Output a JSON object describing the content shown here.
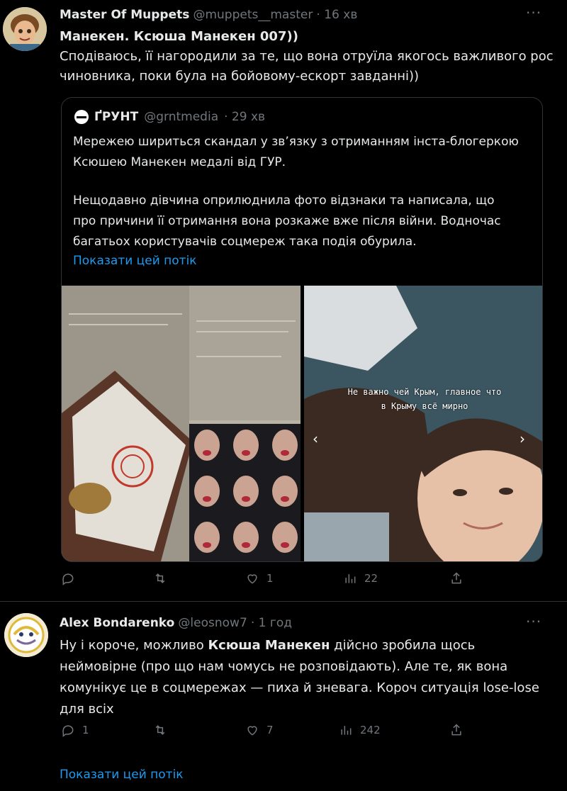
{
  "tweet1": {
    "name": "Master Of Muppets",
    "handle": "@muppets__master",
    "time": "· 16 хв",
    "line1": "Манекен. Ксюша Манекен 007))",
    "line2": "Сподіваюсь, її нагородили за те, що вона отруїла якогось важливого рос",
    "line3": "чиновника, поки була на бойовому-ескорт завданні))",
    "actions": {
      "reply": "",
      "retweet": "",
      "like": "1",
      "views": "22"
    }
  },
  "quote": {
    "name": "ҐРУНТ",
    "handle": "@grntmedia",
    "time": "· 29 хв",
    "p1_line1": "Мережею шириться скандал у зв’язку з отриманням інста-блогеркою",
    "p1_line2": "Ксюшею Манекен медалі від ГУР.",
    "p2_line1": "Нещодавно дівчина оприлюднила фото відзнаки та написала, що",
    "p2_line2": "про причини її отримання вона розкаже вже після війни. Водночас",
    "p2_line3": "багатьох користувачів соцмереж така подія обурила.",
    "show_thread": "Показати цей потік",
    "photo_caption_1": "Не важно чей Крым, главное что",
    "photo_caption_2": "в Крыму всё мирно"
  },
  "tweet2": {
    "name": "Alex Bondarenko",
    "handle": "@leosnow7",
    "time": "· 1 год",
    "line1_a": "Ну і короче, можливо ",
    "line1_b": "Ксюша Манекен",
    "line1_c": " дійсно зробила щось",
    "line2": "неймовірне (про що нам чомусь не розповідають). Але те, як вона",
    "line3": "комунікує це в соцмережах — пиха й зневага. Короч ситуація lose-lose",
    "line4": "для всіх",
    "actions": {
      "reply": "1",
      "retweet": "",
      "like": "7",
      "views": "242"
    }
  },
  "footer": {
    "show_thread": "Показати цей потік"
  },
  "colors": {
    "bg": "#000000",
    "text": "#e7e9ea",
    "muted": "#71767b",
    "link": "#1d9bf0",
    "border": "#2f3336"
  }
}
